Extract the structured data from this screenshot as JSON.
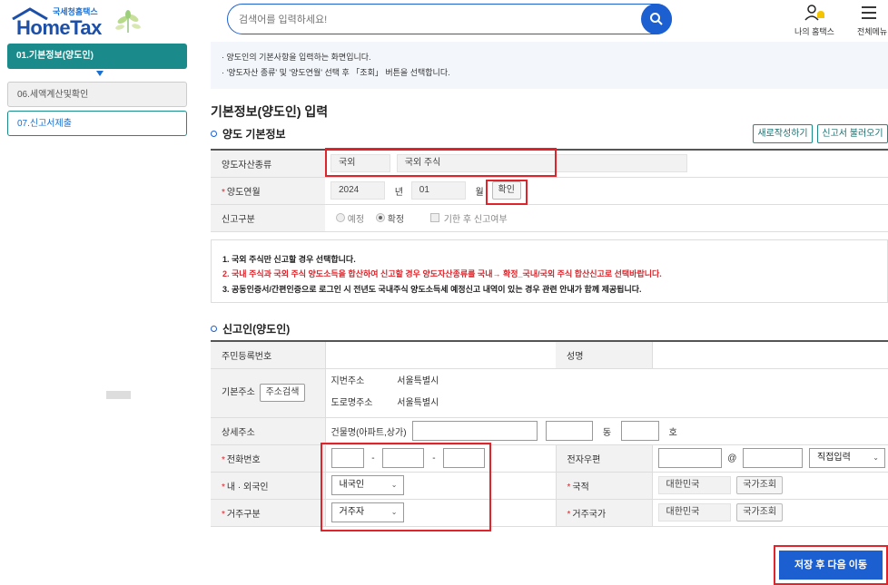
{
  "header": {
    "logo_small": "국세청홈택스",
    "logo_main": "HomeTax",
    "search_placeholder": "검색어를 입력하세요!",
    "my_hometax": "나의 홈택스",
    "all_menu": "전체메뉴"
  },
  "sidebar": {
    "items": [
      {
        "label": "01.기본정보(양도인)"
      },
      {
        "label": "06.세액계산및확인"
      },
      {
        "label": "07.신고서제출"
      }
    ]
  },
  "info": {
    "line1": "· 양도인의 기본사항을 입력하는 화면입니다.",
    "line2": "· '양도자산 종류' 및 '양도연월' 선택 후 「조회」 버튼을 선택합니다."
  },
  "main": {
    "title": "기본정보(양도인) 입력",
    "section1_title": "양도 기본정보",
    "new_write_btn": "새로작성하기",
    "load_report_btn": "신고서 불러오기"
  },
  "basic": {
    "asset_type_label": "양도자산종류",
    "asset_type_value1": "국외",
    "asset_type_value2": "국외 주식",
    "transfer_ym_label": "양도연월",
    "year_value": "2024",
    "year_unit": "년",
    "month_value": "01",
    "month_unit": "월",
    "confirm_btn": "확인",
    "report_type_label": "신고구분",
    "opt_preliminary": "예정",
    "opt_final": "확정",
    "opt_late": "기한 후 신고여부"
  },
  "notice": {
    "line1": "1. 국외 주식만 신고할 경우 선택합니다.",
    "line2": "2. 국내 주식과 국외 주식 양도소득을 합산하여 신고할 경우 양도자산종류를 국내→ 확정_국내/국외 주식 합산신고로 선택바랍니다.",
    "line3": "3. 공동인증서/간편인증으로 로그인 시 전년도 국내주식 양도소득세 예정신고 내역이 있는 경우 관련 안내가 함께 제공됩니다.",
    "line2_color": "#e0242b"
  },
  "reporter": {
    "section_title": "신고인(양도인)",
    "rrn_label": "주민등록번호",
    "name_label": "성명",
    "address_label": "기본주소",
    "address_search_btn": "주소검색",
    "jibun_label": "지번주소",
    "jibun_value": "서울특별시",
    "road_label": "도로명주소",
    "road_value": "서울특별시",
    "detail_label": "상세주소",
    "building_label": "건물명(아파트,상가)",
    "dong_unit": "동",
    "ho_unit": "호",
    "phone_label": "전화번호",
    "dash": "-",
    "email_label": "전자우편",
    "at": "@",
    "email_domain_select": "직접입력",
    "nationality_type_label": "내 · 외국인",
    "nationality_type_value": "내국인",
    "country_label": "국적",
    "country_value": "대한민국",
    "country_lookup_btn": "국가조회",
    "residence_label": "거주구분",
    "residence_value": "거주자",
    "residence_country_label": "거주국가",
    "residence_country_value": "대한민국",
    "residence_lookup_btn": "국가조회"
  },
  "footer": {
    "save_next_btn": "저장 후 다음 이동"
  },
  "colors": {
    "accent": "#1b5fd1",
    "teal": "#1a8a8a",
    "highlight_red": "#e0242b"
  }
}
